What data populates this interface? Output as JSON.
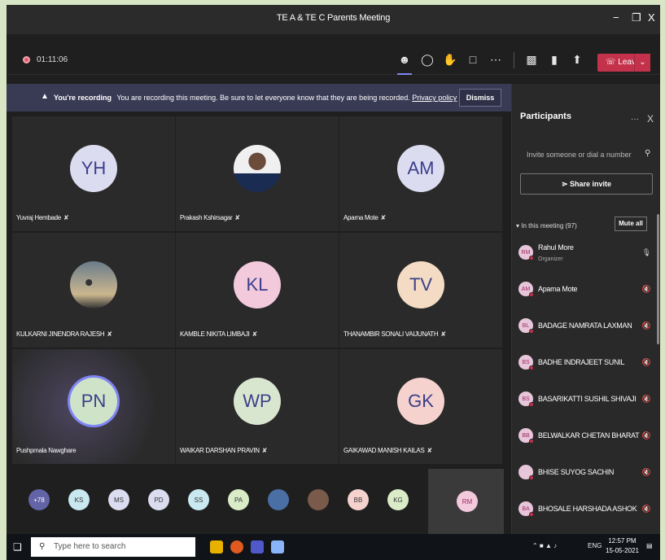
{
  "window": {
    "title": "TE A & TE C Parents Meeting",
    "minimize": "−",
    "maximize": "❐",
    "close": "X"
  },
  "toolbar": {
    "timer": "01:11:06",
    "icons": [
      "participants-icon",
      "chat-icon",
      "reactions-icon",
      "rooms-icon",
      "more-icon",
      "camera-off-icon",
      "mic-icon",
      "share-icon"
    ],
    "leave_label": "Leave",
    "leave_color": "#c4314b"
  },
  "banner": {
    "title": "You're recording",
    "message": "You are recording this meeting. Be sure to let everyone know that they are being recorded.",
    "link": "Privacy policy",
    "dismiss": "Dismiss"
  },
  "tiles": [
    {
      "initials": "YH",
      "name": "Yuvraj Hembade",
      "color": "#dcdcf0"
    },
    {
      "initials": "",
      "name": "Prakash Kshirsagar",
      "photo": "pk"
    },
    {
      "initials": "AM",
      "name": "Aparna Mote",
      "color": "#dcdcf0"
    },
    {
      "initials": "",
      "name": "KULKARNI JINENDRA RAJESH",
      "photo": "kj"
    },
    {
      "initials": "KL",
      "name": "KAMBLE NIKITA LIMBAJI",
      "color": "#f3c9dc"
    },
    {
      "initials": "TV",
      "name": "THANAMBIR SONALI VAIJUNATH",
      "color": "#f4dcc4"
    },
    {
      "initials": "PN",
      "name": "Pushpmala Nawghare",
      "color": "#cfe3c8"
    },
    {
      "initials": "WP",
      "name": "WAIKAR DARSHAN PRAVIN",
      "color": "#d9e6cf"
    },
    {
      "initials": "GK",
      "name": "GAIKAWAD MANISH KAILAS",
      "color": "#f6d2ce"
    }
  ],
  "strip": {
    "chips": [
      {
        "label": "+78",
        "color": "#6264a7"
      },
      {
        "label": "KS",
        "color": "#c9e8ef"
      },
      {
        "label": "MS",
        "color": "#dcdcf0"
      },
      {
        "label": "PD",
        "color": "#dcdcf0"
      },
      {
        "label": "SS",
        "color": "#c9e8ef"
      },
      {
        "label": "PA",
        "color": "#d9ecc7"
      },
      {
        "label": "",
        "color": "#4a6fa5"
      },
      {
        "label": "",
        "color": "#7a5a4a"
      },
      {
        "label": "BB",
        "color": "#f6d2ce"
      },
      {
        "label": "KG",
        "color": "#d9ecc7"
      }
    ],
    "self": "RM"
  },
  "panel": {
    "title": "Participants",
    "more": "···",
    "close": "X",
    "invite_placeholder": "Invite someone or dial a number",
    "share_invite": "Share invite",
    "in_meeting": "In this meeting (97)",
    "mute_all": "Mute all",
    "participants": [
      {
        "initials": "RM",
        "name": "Rahul More",
        "role": "Organizer",
        "mic": "🎙"
      },
      {
        "initials": "AM",
        "name": "Aparna Mote",
        "role": "",
        "mic": "🔇"
      },
      {
        "initials": "BL",
        "name": "BADAGE NAMRATA LAXMAN",
        "role": "",
        "mic": "🔇"
      },
      {
        "initials": "BS",
        "name": "BADHE INDRAJEET SUNIL",
        "role": "",
        "mic": "🔇"
      },
      {
        "initials": "BS",
        "name": "BASARIKATTI SUSHIL SHIVAJI",
        "role": "",
        "mic": "🔇"
      },
      {
        "initials": "BB",
        "name": "BELWALKAR CHETAN BHARAT",
        "role": "",
        "mic": "🔇"
      },
      {
        "initials": "",
        "name": "BHISE SUYOG SACHIN",
        "role": "",
        "mic": "🔇"
      },
      {
        "initials": "BA",
        "name": "BHOSALE HARSHADA ASHOK",
        "role": "",
        "mic": "🔇"
      }
    ]
  },
  "taskbar": {
    "search_placeholder": "Type here to search",
    "tray": "ENG",
    "time": "12:57 PM",
    "date": "15-05-2021"
  }
}
